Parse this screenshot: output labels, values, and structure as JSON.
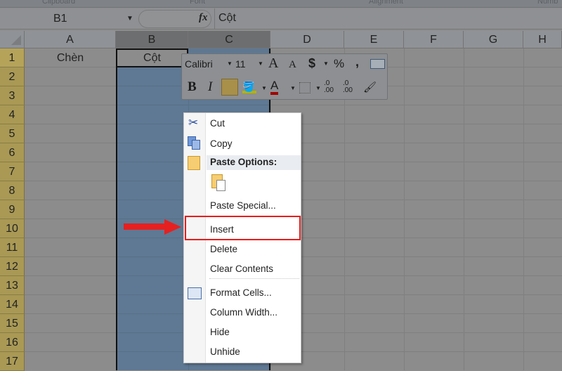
{
  "ribbon": {
    "groups": [
      "Clipboard",
      "Font",
      "Alignment",
      "Numb"
    ]
  },
  "formula_bar": {
    "name_box": "B1",
    "fx": "fx",
    "value": "Cột"
  },
  "columns": [
    "A",
    "B",
    "C",
    "D",
    "E",
    "F",
    "G",
    "H"
  ],
  "rows": [
    "1",
    "2",
    "3",
    "4",
    "5",
    "6",
    "7",
    "8",
    "9",
    "10",
    "11",
    "12",
    "13",
    "14",
    "15",
    "16",
    "17"
  ],
  "cells": {
    "A1": "Chèn",
    "B1": "Cột"
  },
  "mini_toolbar": {
    "font": "Calibri",
    "size": "11",
    "grow": "A",
    "shrink": "A",
    "currency": "$",
    "percent": "%",
    "comma": ",",
    "bold": "B",
    "italic": "I",
    "font_color": "A",
    "inc_decimal": ".0\n.00",
    "dec_decimal": ".0\n.00"
  },
  "context_menu": {
    "items": [
      {
        "label": "Cut",
        "icon": "scissors-icon"
      },
      {
        "label": "Copy",
        "icon": "copy-icon"
      },
      {
        "label": "Paste Options:",
        "icon": "paste-icon"
      },
      {
        "label": "Paste Special..."
      },
      {
        "label": "Insert",
        "highlighted": true
      },
      {
        "label": "Delete"
      },
      {
        "label": "Clear Contents"
      },
      {
        "label": "Format Cells...",
        "icon": "format-cells-icon"
      },
      {
        "label": "Column Width..."
      },
      {
        "label": "Hide"
      },
      {
        "label": "Unhide"
      }
    ]
  },
  "colors": {
    "highlight": "#e81c1c",
    "selection": "#5f7893"
  }
}
